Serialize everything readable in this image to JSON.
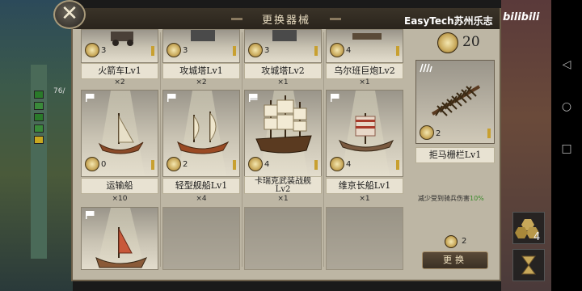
{
  "title": "更换器械",
  "watermark": "EasyTech苏州乐志",
  "bili_logo": "bilibili",
  "map": {
    "side_text": "76/"
  },
  "top_row": [
    {
      "name": "火箭车Lv1",
      "gear": "3",
      "count": "×2"
    },
    {
      "name": "攻城塔Lv1",
      "gear": "3",
      "count": "×2"
    },
    {
      "name": "攻城塔Lv2",
      "gear": "3",
      "count": "×1"
    },
    {
      "name": "乌尔班巨炮Lv2",
      "gear": "4",
      "count": "×1"
    }
  ],
  "mid_row": [
    {
      "name": "运输船",
      "gear": "0",
      "count": "×10"
    },
    {
      "name": "轻型舰船Lv1",
      "gear": "2",
      "count": "×4"
    },
    {
      "name": "卡瑞克武装战舰Lv2",
      "gear": "4",
      "count": "×1"
    },
    {
      "name": "维京长船Lv1",
      "gear": "4",
      "count": "×1"
    }
  ],
  "selected": {
    "gear_total": "20",
    "name": "拒马栅栏Lv1",
    "gear": "2",
    "desc_prefix": "减少受到骑兵伤害",
    "desc_pct": "10%",
    "cost": "2",
    "swap_label": "更换"
  },
  "side": {
    "stack_count": "4"
  },
  "colors": {
    "panel": "#bdb6a4",
    "title_bar": "#2a241c",
    "accent_gold": "#c8a85a",
    "bonus_green": "#3a8a2a"
  },
  "icons": [
    "close-icon",
    "gear-icon",
    "ship-icon",
    "flag-icon",
    "hexagon-icon",
    "hourglass-icon",
    "back-icon",
    "home-icon",
    "recent-apps-icon"
  ]
}
